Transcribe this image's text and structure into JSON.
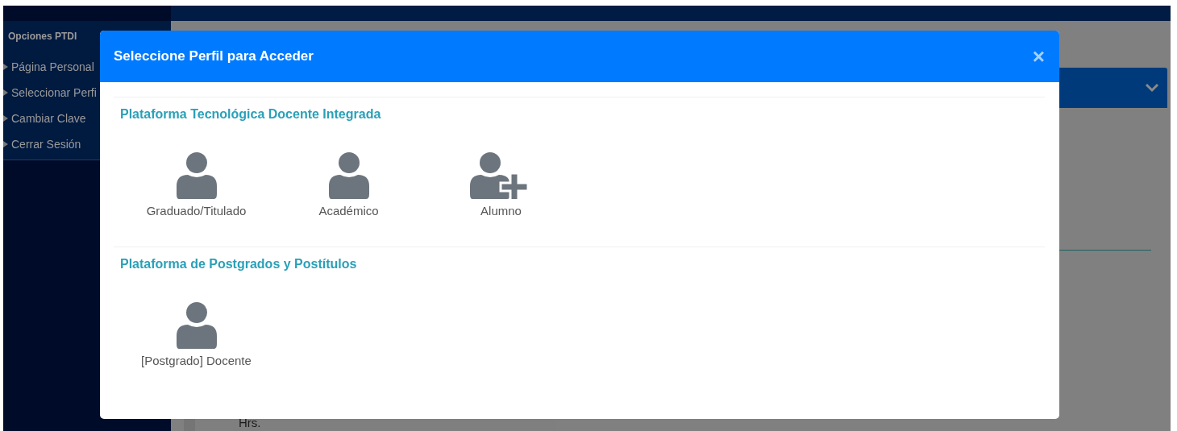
{
  "sidebar": {
    "title": "Opciones PTDI",
    "items": [
      {
        "label": "Página Personal"
      },
      {
        "label": "Seleccionar Perfi"
      },
      {
        "label": "Cambiar Clave"
      },
      {
        "label": "Cerrar Sesión"
      }
    ]
  },
  "background": {
    "card_text": "Hrs."
  },
  "modal": {
    "title": "Seleccione Perfil para Acceder",
    "close": "×",
    "sections": [
      {
        "title": "Plataforma Tecnológica Docente Integrada",
        "profiles": [
          {
            "label": "Graduado/Titulado",
            "kind": "user"
          },
          {
            "label": "Académico",
            "kind": "user"
          },
          {
            "label": "Alumno",
            "kind": "user-add"
          }
        ]
      },
      {
        "title": "Plataforma de Postgrados y Postítulos",
        "profiles": [
          {
            "label": "[Postgrado] Docente",
            "kind": "user"
          }
        ]
      }
    ]
  }
}
